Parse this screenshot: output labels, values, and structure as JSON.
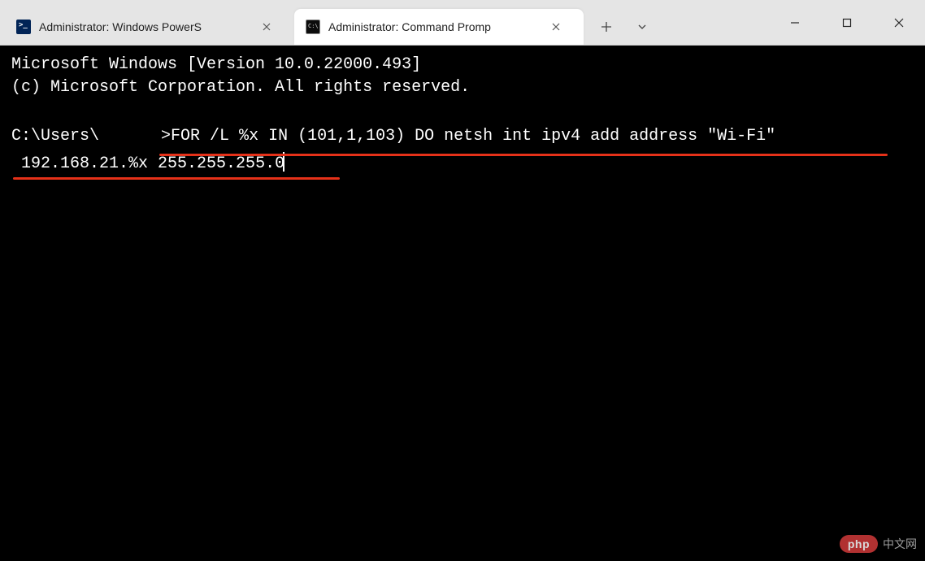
{
  "tabs": [
    {
      "label": "Administrator: Windows PowerS",
      "icon": "powershell-icon",
      "active": false
    },
    {
      "label": "Administrator: Command Promp",
      "icon": "cmd-icon",
      "active": true
    }
  ],
  "terminal": {
    "version_line": "Microsoft Windows [Version 10.0.22000.493]",
    "copyright_line": "(c) Microsoft Corporation. All rights reserved.",
    "prompt_prefix": "C:\\Users\\",
    "prompt_suffix": ">",
    "command_line1": "FOR /L %x IN (101,1,103) DO netsh int ipv4 add address \"Wi-Fi\"",
    "command_line2": " 192.168.21.%x 255.255.255.0"
  },
  "watermark": {
    "brand": "php",
    "text": "中文网"
  }
}
